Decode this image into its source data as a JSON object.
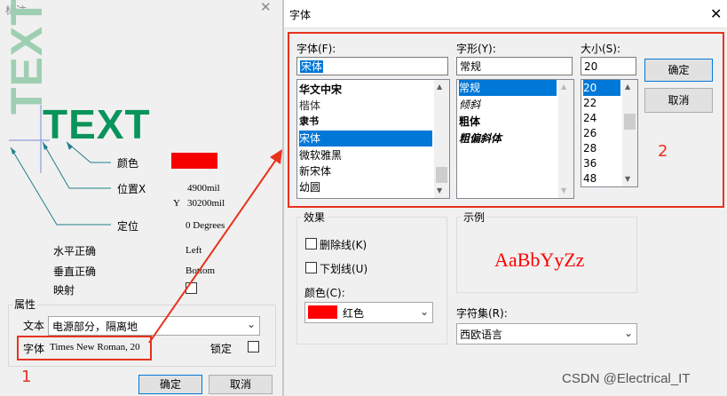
{
  "annotation_dialog": {
    "title": "标注",
    "close_glyph": "✕",
    "preview_vertical_text": "TEXT",
    "preview_main_text": "TEXT",
    "color_label": "颜色",
    "color_value_hex": "#f70000",
    "position_label": "位置X",
    "x_value": "4900mil",
    "y_label": "Y",
    "y_value": "30200mil",
    "anchor_label": "定位",
    "anchor_value": "0 Degrees",
    "h_justify_label": "水平正确",
    "h_justify_value": "Left",
    "v_justify_label": "垂直正确",
    "v_justify_value": "Bottom",
    "mirror_label": "映射",
    "props_group": "属性",
    "text_label": "文本",
    "text_value": "电源部分，隔离地",
    "font_label": "字体",
    "font_value": "Times New Roman, 20",
    "lock_label": "锁定",
    "ok": "确定",
    "cancel": "取消",
    "callout_number": "1"
  },
  "font_dialog": {
    "title": "字体",
    "close_glyph": "✕",
    "font_label": "字体(F):",
    "font_value": "宋体",
    "fonts": [
      "华文中宋",
      "楷体",
      "隶书",
      "宋体",
      "微软雅黑",
      "新宋体",
      "幼圆"
    ],
    "selected_font": "宋体",
    "style_label": "字形(Y):",
    "style_value": "常规",
    "styles": [
      "常规",
      "倾斜",
      "粗体",
      "粗偏斜体"
    ],
    "size_label": "大小(S):",
    "size_value": "20",
    "sizes": [
      "20",
      "22",
      "24",
      "26",
      "28",
      "36",
      "48"
    ],
    "ok": "确定",
    "cancel": "取消",
    "effects_group": "效果",
    "strikeout": "删除线(K)",
    "underline": "下划线(U)",
    "color_label": "颜色(C):",
    "color_name": "红色",
    "color_hex": "#ff0000",
    "sample_group": "示例",
    "sample_text": "AaBbYyZz",
    "charset_label": "字符集(R):",
    "charset_value": "西欧语言",
    "callout_number": "2"
  },
  "watermark": "CSDN @Electrical_IT",
  "annotation_color": "#e8321e"
}
